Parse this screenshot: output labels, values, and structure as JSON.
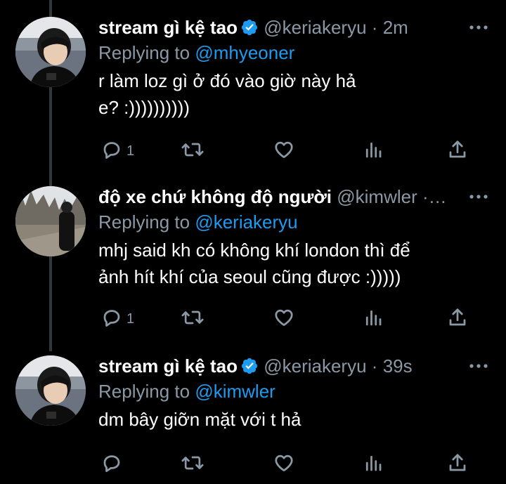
{
  "tweets": [
    {
      "display_name": "stream gì kệ tao",
      "handle": "@keriakeryu",
      "separator": "·",
      "time": "2m",
      "replying_label": "Replying to",
      "replying_to": "@mhyeoner",
      "text": "r làm loz gì ở đó vào giờ này hả\ne? :))))))))))",
      "reply_count": "1",
      "verified": true,
      "avatar": "profile-photo-boy-dark-hair"
    },
    {
      "display_name": "độ xe chứ không độ người",
      "handle": "@kimwler",
      "separator": "·…",
      "time": "",
      "replying_label": "Replying to",
      "replying_to": "@keriakeryu",
      "text": "mhj said kh có không khí london thì để\nảnh hít khí của seoul cũng được :)))))",
      "reply_count": "1",
      "verified": false,
      "avatar": "profile-photo-person-outdoors"
    },
    {
      "display_name": "stream gì kệ tao",
      "handle": "@keriakeryu",
      "separator": "·",
      "time": "39s",
      "replying_label": "Replying to",
      "replying_to": "@kimwler",
      "text": "dm bây giỡn mặt với t hả",
      "reply_count": "",
      "verified": true,
      "avatar": "profile-photo-boy-dark-hair"
    }
  ],
  "icons": {
    "reply": "reply-icon",
    "retweet": "retweet-icon",
    "like": "heart-icon",
    "analytics": "analytics-icon",
    "share": "share-icon",
    "more": "more-icon",
    "verified": "verified-badge-icon"
  },
  "colors": {
    "background": "#000000",
    "text": "#ffffff",
    "muted": "#8b98a5",
    "accent": "#1d9bf0",
    "thread_line": "#333639"
  }
}
